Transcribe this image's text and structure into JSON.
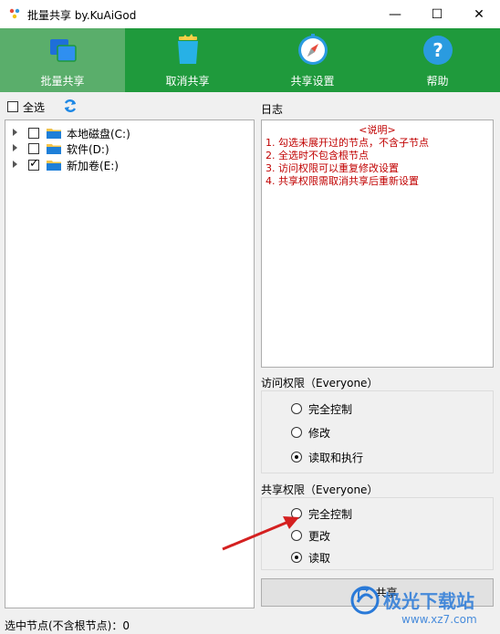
{
  "window": {
    "title": "批量共享 by.KuAiGod",
    "minimize": "—",
    "maximize": "☐",
    "close": "✕"
  },
  "ribbon": {
    "items": [
      {
        "label": "批量共享",
        "icon": "windows-stack-icon"
      },
      {
        "label": "取消共享",
        "icon": "trash-can-icon"
      },
      {
        "label": "共享设置",
        "icon": "compass-icon"
      },
      {
        "label": "帮助",
        "icon": "help-question-icon"
      }
    ],
    "active_color": "#5aae6b",
    "bg_color": "#1f9a3c"
  },
  "left": {
    "select_all_label": "全选",
    "refresh_icon": "refresh-icon",
    "tree": [
      {
        "label": "本地磁盘(C:)",
        "checked": false
      },
      {
        "label": "软件(D:)",
        "checked": false
      },
      {
        "label": "新加卷(E:)",
        "checked": true
      }
    ]
  },
  "log": {
    "title": "日志",
    "header": "<说明>",
    "lines": [
      "1. 勾选未展开过的节点，不含子节点",
      "2. 全选时不包含根节点",
      "3. 访问权限可以重复修改设置",
      "4. 共享权限需取消共享后重新设置"
    ],
    "text_color": "#c00000"
  },
  "access": {
    "title": "访问权限（Everyone）",
    "options": [
      "完全控制",
      "修改",
      "读取和执行"
    ],
    "selected": "读取和执行"
  },
  "share_perm": {
    "title": "共享权限（Everyone）",
    "options": [
      "完全控制",
      "更改",
      "读取"
    ],
    "selected": "读取"
  },
  "share_button": {
    "label": "共享",
    "icon": "share-arrow-icon"
  },
  "status": {
    "text": "选中节点(不含根节点)：0"
  },
  "watermark": {
    "text": "极光下载站",
    "sub": "www.xz7.com"
  }
}
